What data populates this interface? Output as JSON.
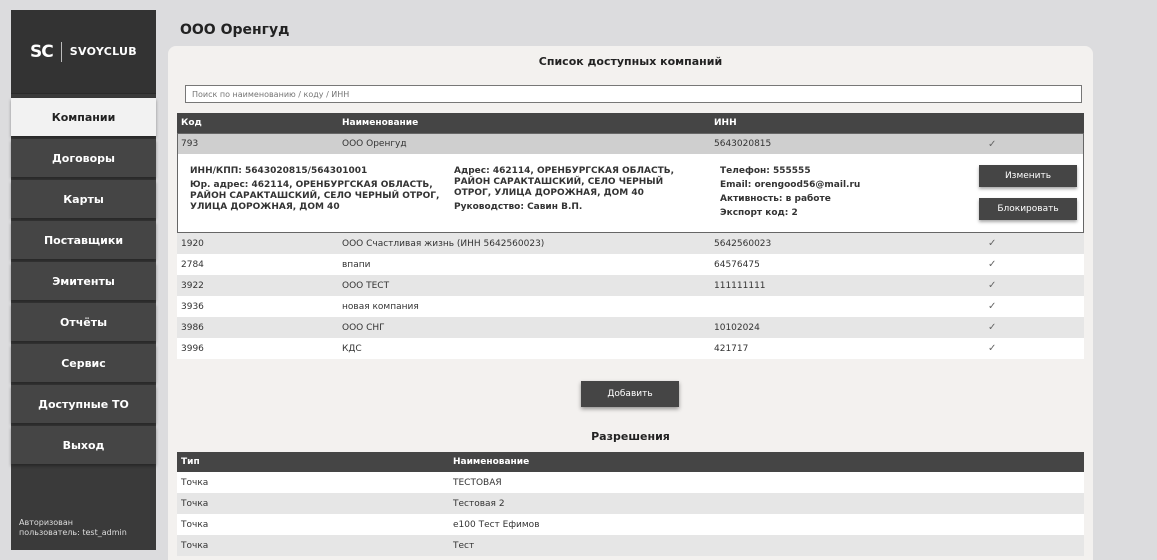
{
  "brand": {
    "mark": "SC",
    "name": "SVOYCLUB"
  },
  "nav": [
    {
      "label": "Компании"
    },
    {
      "label": "Договоры"
    },
    {
      "label": "Карты"
    },
    {
      "label": "Поставщики"
    },
    {
      "label": "Эмитенты"
    },
    {
      "label": "Отчёты"
    },
    {
      "label": "Сервис"
    },
    {
      "label": "Доступные ТО"
    },
    {
      "label": "Выход"
    }
  ],
  "auth": {
    "line1": "Авторизован",
    "line2": "пользователь: test_admin"
  },
  "page": {
    "title": "ООО Оренгуд"
  },
  "companies": {
    "title": "Список доступных компаний",
    "search_placeholder": "Поиск по наименованию / коду / ИНН",
    "headers": {
      "code": "Код",
      "name": "Наименование",
      "inn": "ИНН"
    },
    "selected": {
      "code": "793",
      "name": "ООО Оренгуд",
      "inn": "5643020815",
      "check": "✓"
    },
    "detail": {
      "inn_kpp": "ИНН/КПП: 5643020815/564301001",
      "legal_address": "Юр. адрес: 462114, ОРЕНБУРГСКАЯ ОБЛАСТЬ, РАЙОН САРАКТАШСКИЙ, СЕЛО ЧЕРНЫЙ ОТРОГ, УЛИЦА ДОРОЖНАЯ, ДОМ 40",
      "address": "Адрес: 462114, ОРЕНБУРГСКАЯ ОБЛАСТЬ, РАЙОН САРАКТАШСКИЙ, СЕЛО ЧЕРНЫЙ ОТРОГ, УЛИЦА ДОРОЖНАЯ, ДОМ 40",
      "director": "Руководство: Савин В.П.",
      "phone": "Телефон: 555555",
      "email": "Email: orengood56@mail.ru",
      "activity": "Активность: в работе",
      "export_code": "Экспорт код: 2",
      "edit_label": "Изменить",
      "block_label": "Блокировать"
    },
    "rows": [
      {
        "code": "1920",
        "name": "ООО Счастливая жизнь (ИНН 5642560023)",
        "inn": "5642560023",
        "check": "✓"
      },
      {
        "code": "2784",
        "name": "впапи",
        "inn": "64576475",
        "check": "✓"
      },
      {
        "code": "3922",
        "name": "ООО ТЕСТ",
        "inn": "111111111",
        "check": "✓"
      },
      {
        "code": "3936",
        "name": "новая компания",
        "inn": "",
        "check": "✓"
      },
      {
        "code": "3986",
        "name": "ООО СНГ",
        "inn": "10102024",
        "check": "✓"
      },
      {
        "code": "3996",
        "name": "КДС",
        "inn": "421717",
        "check": "✓"
      }
    ],
    "add_label": "Добавить"
  },
  "permissions": {
    "title": "Разрешения",
    "headers": {
      "type": "Тип",
      "name": "Наименование"
    },
    "rows": [
      {
        "type": "Точка",
        "name": "ТЕСТОВАЯ"
      },
      {
        "type": "Точка",
        "name": "Тестовая 2"
      },
      {
        "type": "Точка",
        "name": "е100 Тест Ефимов"
      },
      {
        "type": "Точка",
        "name": "Тест"
      }
    ]
  }
}
